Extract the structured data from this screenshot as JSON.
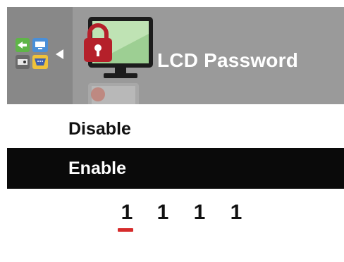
{
  "header": {
    "title": "LCD Password"
  },
  "options": [
    {
      "label": "Disable",
      "selected": false
    },
    {
      "label": "Enable",
      "selected": true
    }
  ],
  "password": {
    "digits": [
      "1",
      "1",
      "1",
      "1"
    ],
    "active_index": 0
  },
  "colors": {
    "header_bg": "#9a9a9a",
    "nav_bg": "#888888",
    "selected_bg": "#0a0a0a",
    "cursor": "#d62b2b"
  },
  "icons": {
    "nav_icons": [
      "input-source-icon",
      "display-icon",
      "projector-icon",
      "vga-port-icon"
    ],
    "back_arrow": "chevron-left-icon",
    "menu_icon": "monitor-lock-icon"
  }
}
